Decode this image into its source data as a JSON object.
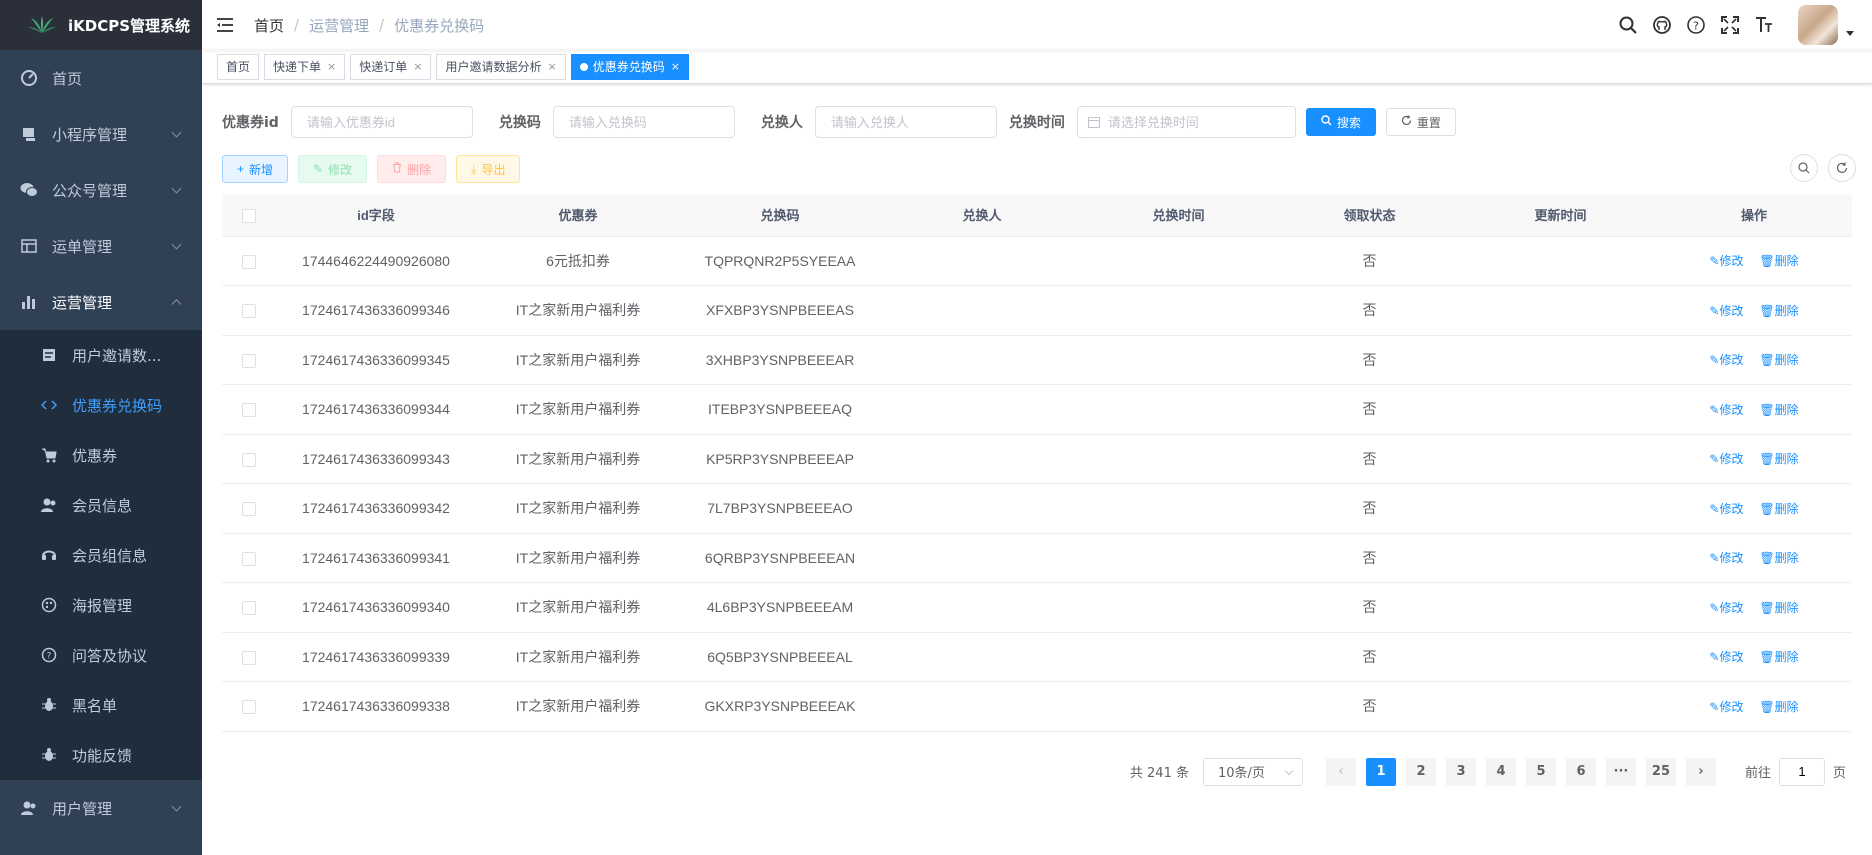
{
  "app": {
    "title": "iKDCPS管理系统"
  },
  "sidebar": {
    "items": [
      {
        "label": "首页",
        "icon": "dashboard-icon"
      },
      {
        "label": "小程序管理",
        "icon": "miniprogram-icon"
      },
      {
        "label": "公众号管理",
        "icon": "wechat-icon"
      },
      {
        "label": "运单管理",
        "icon": "table-icon"
      },
      {
        "label": "运营管理",
        "icon": "chart-icon"
      }
    ],
    "sub_items": [
      {
        "label": "用户邀请数...",
        "icon": "form-icon"
      },
      {
        "label": "优惠券兑换码",
        "icon": "code-icon"
      },
      {
        "label": "优惠券",
        "icon": "cart-icon"
      },
      {
        "label": "会员信息",
        "icon": "peoples-icon"
      },
      {
        "label": "会员组信息",
        "icon": "online-icon"
      },
      {
        "label": "海报管理",
        "icon": "color-icon"
      },
      {
        "label": "问答及协议",
        "icon": "question-icon"
      },
      {
        "label": "黑名单",
        "icon": "bug-icon"
      },
      {
        "label": "功能反馈",
        "icon": "bug2-icon"
      }
    ],
    "bottom_item": {
      "label": "用户管理",
      "icon": "user-icon"
    }
  },
  "breadcrumb": [
    "首页",
    "运营管理",
    "优惠券兑换码"
  ],
  "tags": [
    {
      "label": "首页",
      "closable": false
    },
    {
      "label": "快递下单",
      "closable": true
    },
    {
      "label": "快递订单",
      "closable": true
    },
    {
      "label": "用户邀请数据分析",
      "closable": true
    },
    {
      "label": "优惠券兑换码",
      "closable": true,
      "active": true
    }
  ],
  "search": {
    "coupon_id_label": "优惠券id",
    "coupon_id_placeholder": "请输入优惠券id",
    "code_label": "兑换码",
    "code_placeholder": "请输入兑换码",
    "user_label": "兑换人",
    "user_placeholder": "请输入兑换人",
    "time_label": "兑换时间",
    "time_placeholder": "请选择兑换时间",
    "search_btn": "搜索",
    "reset_btn": "重置"
  },
  "toolbar": {
    "add": "新增",
    "edit": "修改",
    "delete": "删除",
    "export": "导出"
  },
  "table": {
    "headers": [
      "id字段",
      "优惠券",
      "兑换码",
      "兑换人",
      "兑换时间",
      "领取状态",
      "更新时间",
      "操作"
    ],
    "edit_label": "修改",
    "delete_label": "删除",
    "rows": [
      {
        "id": "1744646224490926080",
        "coupon": "6元抵扣券",
        "code": "TQPRQNR2P5SYEEAA",
        "user": "",
        "time": "",
        "status": "否",
        "updated": ""
      },
      {
        "id": "1724617436336099346",
        "coupon": "IT之家新用户福利券",
        "code": "XFXBP3YSNPBEEEAS",
        "user": "",
        "time": "",
        "status": "否",
        "updated": ""
      },
      {
        "id": "1724617436336099345",
        "coupon": "IT之家新用户福利券",
        "code": "3XHBP3YSNPBEEEAR",
        "user": "",
        "time": "",
        "status": "否",
        "updated": ""
      },
      {
        "id": "1724617436336099344",
        "coupon": "IT之家新用户福利券",
        "code": "ITEBP3YSNPBEEEAQ",
        "user": "",
        "time": "",
        "status": "否",
        "updated": ""
      },
      {
        "id": "1724617436336099343",
        "coupon": "IT之家新用户福利券",
        "code": "KP5RP3YSNPBEEEAP",
        "user": "",
        "time": "",
        "status": "否",
        "updated": ""
      },
      {
        "id": "1724617436336099342",
        "coupon": "IT之家新用户福利券",
        "code": "7L7BP3YSNPBEEEAO",
        "user": "",
        "time": "",
        "status": "否",
        "updated": ""
      },
      {
        "id": "1724617436336099341",
        "coupon": "IT之家新用户福利券",
        "code": "6QRBP3YSNPBEEEAN",
        "user": "",
        "time": "",
        "status": "否",
        "updated": ""
      },
      {
        "id": "1724617436336099340",
        "coupon": "IT之家新用户福利券",
        "code": "4L6BP3YSNPBEEEAM",
        "user": "",
        "time": "",
        "status": "否",
        "updated": ""
      },
      {
        "id": "1724617436336099339",
        "coupon": "IT之家新用户福利券",
        "code": "6Q5BP3YSNPBEEEAL",
        "user": "",
        "time": "",
        "status": "否",
        "updated": ""
      },
      {
        "id": "1724617436336099338",
        "coupon": "IT之家新用户福利券",
        "code": "GKXRP3YSNPBEEEAK",
        "user": "",
        "time": "",
        "status": "否",
        "updated": ""
      }
    ]
  },
  "pagination": {
    "total_text": "共 241 条",
    "page_size": "10条/页",
    "pages": [
      "1",
      "2",
      "3",
      "4",
      "5",
      "6",
      "···",
      "25"
    ],
    "current": "1",
    "goto_label": "前往",
    "goto_value": "1",
    "page_unit": "页"
  },
  "colors": {
    "sidebar_bg": "#304156",
    "accent": "#1890ff",
    "sub_menu_bg": "#1f2d3d"
  }
}
